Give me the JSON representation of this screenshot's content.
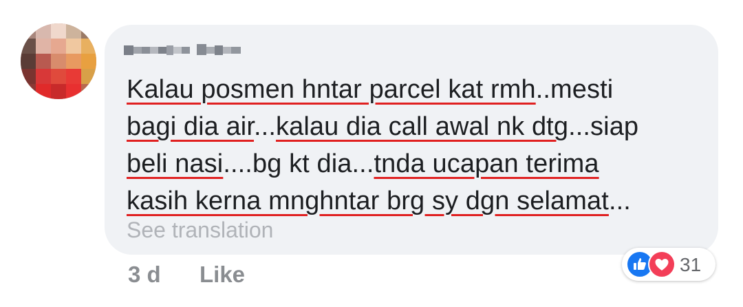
{
  "comment": {
    "lines": [
      [
        {
          "text": "Kalau posmen hntar parcel kat rmh",
          "u": true
        },
        {
          "text": "..mesti",
          "u": false
        }
      ],
      [
        {
          "text": "bagi dia air",
          "u": true
        },
        {
          "text": "...",
          "u": false
        },
        {
          "text": "kalau dia call awal nk dtg",
          "u": true
        },
        {
          "text": "...siap",
          "u": false
        }
      ],
      [
        {
          "text": "beli nasi",
          "u": true
        },
        {
          "text": "....bg kt dia...",
          "u": false
        },
        {
          "text": "tnda ucapan terima",
          "u": true
        }
      ],
      [
        {
          "text": "kasih kerna mnghntar brg sy dgn selamat",
          "u": true
        },
        {
          "text": "...",
          "u": false
        }
      ]
    ],
    "see_translation": "See translation"
  },
  "meta": {
    "time": "3 d",
    "like": "Like"
  },
  "reactions": {
    "icons": [
      "thumbs-up-icon",
      "heart-icon"
    ],
    "count": "31",
    "like_color": "#1877f2",
    "love_color": "#f33e58"
  },
  "colors": {
    "bubble": "#f0f2f5",
    "underline": "#e02020",
    "meta_text": "#8a8d91"
  }
}
